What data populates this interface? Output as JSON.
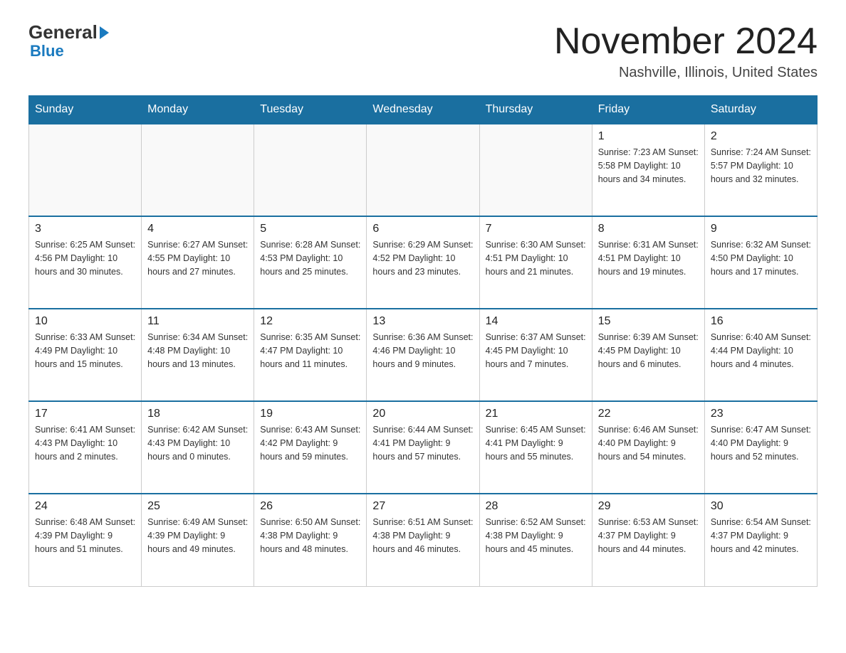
{
  "header": {
    "logo_general": "General",
    "logo_blue": "Blue",
    "title": "November 2024",
    "subtitle": "Nashville, Illinois, United States"
  },
  "days_of_week": [
    "Sunday",
    "Monday",
    "Tuesday",
    "Wednesday",
    "Thursday",
    "Friday",
    "Saturday"
  ],
  "weeks": [
    {
      "days": [
        {
          "number": "",
          "info": ""
        },
        {
          "number": "",
          "info": ""
        },
        {
          "number": "",
          "info": ""
        },
        {
          "number": "",
          "info": ""
        },
        {
          "number": "",
          "info": ""
        },
        {
          "number": "1",
          "info": "Sunrise: 7:23 AM\nSunset: 5:58 PM\nDaylight: 10 hours and 34 minutes."
        },
        {
          "number": "2",
          "info": "Sunrise: 7:24 AM\nSunset: 5:57 PM\nDaylight: 10 hours and 32 minutes."
        }
      ]
    },
    {
      "days": [
        {
          "number": "3",
          "info": "Sunrise: 6:25 AM\nSunset: 4:56 PM\nDaylight: 10 hours and 30 minutes."
        },
        {
          "number": "4",
          "info": "Sunrise: 6:27 AM\nSunset: 4:55 PM\nDaylight: 10 hours and 27 minutes."
        },
        {
          "number": "5",
          "info": "Sunrise: 6:28 AM\nSunset: 4:53 PM\nDaylight: 10 hours and 25 minutes."
        },
        {
          "number": "6",
          "info": "Sunrise: 6:29 AM\nSunset: 4:52 PM\nDaylight: 10 hours and 23 minutes."
        },
        {
          "number": "7",
          "info": "Sunrise: 6:30 AM\nSunset: 4:51 PM\nDaylight: 10 hours and 21 minutes."
        },
        {
          "number": "8",
          "info": "Sunrise: 6:31 AM\nSunset: 4:51 PM\nDaylight: 10 hours and 19 minutes."
        },
        {
          "number": "9",
          "info": "Sunrise: 6:32 AM\nSunset: 4:50 PM\nDaylight: 10 hours and 17 minutes."
        }
      ]
    },
    {
      "days": [
        {
          "number": "10",
          "info": "Sunrise: 6:33 AM\nSunset: 4:49 PM\nDaylight: 10 hours and 15 minutes."
        },
        {
          "number": "11",
          "info": "Sunrise: 6:34 AM\nSunset: 4:48 PM\nDaylight: 10 hours and 13 minutes."
        },
        {
          "number": "12",
          "info": "Sunrise: 6:35 AM\nSunset: 4:47 PM\nDaylight: 10 hours and 11 minutes."
        },
        {
          "number": "13",
          "info": "Sunrise: 6:36 AM\nSunset: 4:46 PM\nDaylight: 10 hours and 9 minutes."
        },
        {
          "number": "14",
          "info": "Sunrise: 6:37 AM\nSunset: 4:45 PM\nDaylight: 10 hours and 7 minutes."
        },
        {
          "number": "15",
          "info": "Sunrise: 6:39 AM\nSunset: 4:45 PM\nDaylight: 10 hours and 6 minutes."
        },
        {
          "number": "16",
          "info": "Sunrise: 6:40 AM\nSunset: 4:44 PM\nDaylight: 10 hours and 4 minutes."
        }
      ]
    },
    {
      "days": [
        {
          "number": "17",
          "info": "Sunrise: 6:41 AM\nSunset: 4:43 PM\nDaylight: 10 hours and 2 minutes."
        },
        {
          "number": "18",
          "info": "Sunrise: 6:42 AM\nSunset: 4:43 PM\nDaylight: 10 hours and 0 minutes."
        },
        {
          "number": "19",
          "info": "Sunrise: 6:43 AM\nSunset: 4:42 PM\nDaylight: 9 hours and 59 minutes."
        },
        {
          "number": "20",
          "info": "Sunrise: 6:44 AM\nSunset: 4:41 PM\nDaylight: 9 hours and 57 minutes."
        },
        {
          "number": "21",
          "info": "Sunrise: 6:45 AM\nSunset: 4:41 PM\nDaylight: 9 hours and 55 minutes."
        },
        {
          "number": "22",
          "info": "Sunrise: 6:46 AM\nSunset: 4:40 PM\nDaylight: 9 hours and 54 minutes."
        },
        {
          "number": "23",
          "info": "Sunrise: 6:47 AM\nSunset: 4:40 PM\nDaylight: 9 hours and 52 minutes."
        }
      ]
    },
    {
      "days": [
        {
          "number": "24",
          "info": "Sunrise: 6:48 AM\nSunset: 4:39 PM\nDaylight: 9 hours and 51 minutes."
        },
        {
          "number": "25",
          "info": "Sunrise: 6:49 AM\nSunset: 4:39 PM\nDaylight: 9 hours and 49 minutes."
        },
        {
          "number": "26",
          "info": "Sunrise: 6:50 AM\nSunset: 4:38 PM\nDaylight: 9 hours and 48 minutes."
        },
        {
          "number": "27",
          "info": "Sunrise: 6:51 AM\nSunset: 4:38 PM\nDaylight: 9 hours and 46 minutes."
        },
        {
          "number": "28",
          "info": "Sunrise: 6:52 AM\nSunset: 4:38 PM\nDaylight: 9 hours and 45 minutes."
        },
        {
          "number": "29",
          "info": "Sunrise: 6:53 AM\nSunset: 4:37 PM\nDaylight: 9 hours and 44 minutes."
        },
        {
          "number": "30",
          "info": "Sunrise: 6:54 AM\nSunset: 4:37 PM\nDaylight: 9 hours and 42 minutes."
        }
      ]
    }
  ]
}
